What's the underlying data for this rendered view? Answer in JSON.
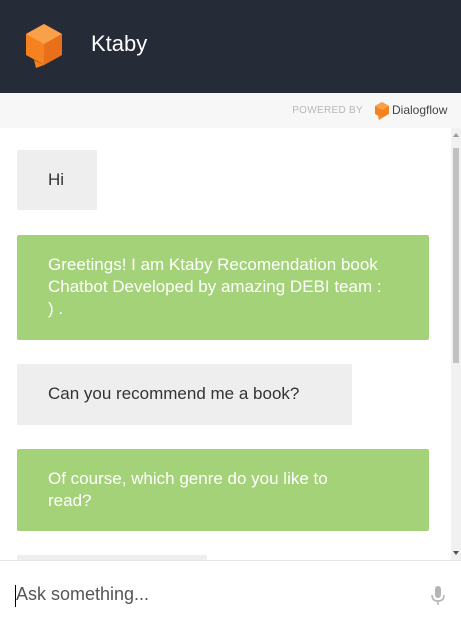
{
  "header": {
    "title": "Ktaby",
    "logo_icon": "dialogflow-cube-icon",
    "background": "#262b38",
    "logo_color": "#f5821f"
  },
  "powered_by": {
    "label": "POWERED BY",
    "brand": "Dialogflow",
    "brand_icon": "dialogflow-icon"
  },
  "messages": [
    {
      "from": "user",
      "text": "Hi"
    },
    {
      "from": "bot",
      "text": "Greetings! I am Ktaby Recomendation book Chatbot Developed by amazing DEBI team : ) ."
    },
    {
      "from": "user",
      "text": "Can you recommend me a book?"
    },
    {
      "from": "bot",
      "text": "Of course, which genre do you like to read?"
    },
    {
      "from": "user",
      "text": ""
    }
  ],
  "colors": {
    "user_bubble": "#eeeeee",
    "bot_bubble": "#a4d279",
    "user_text": "#333333",
    "bot_text": "#ffffff"
  },
  "input": {
    "placeholder": "Ask something...",
    "value": "",
    "mic_icon": "microphone-icon"
  }
}
